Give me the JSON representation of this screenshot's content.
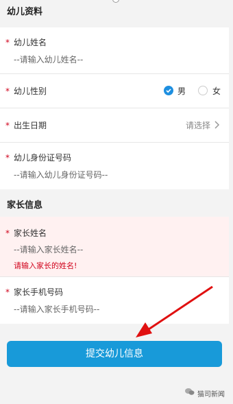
{
  "sections": {
    "child_title": "幼儿资料",
    "parent_title": "家长信息"
  },
  "child": {
    "name_label": "幼儿姓名",
    "name_placeholder": "--请输入幼儿姓名--",
    "gender_label": "幼儿性别",
    "gender_options": [
      "男",
      "女"
    ],
    "gender_selected": "男",
    "birth_label": "出生日期",
    "birth_value": "请选择",
    "id_label": "幼儿身份证号码",
    "id_placeholder": "--请输入幼儿身份证号码--"
  },
  "parent": {
    "name_label": "家长姓名",
    "name_placeholder": "--请输入家长姓名--",
    "name_error": "请输入家长的姓名!",
    "phone_label": "家长手机号码",
    "phone_placeholder": "--请输入家长手机号码--"
  },
  "required_mark": "*",
  "submit_label": "提交幼儿信息",
  "watermark": "猫司新闻",
  "colors": {
    "accent": "#189ad9",
    "required": "#d0021b",
    "error_bg": "#fff1f1",
    "arrow": "#e01010"
  }
}
